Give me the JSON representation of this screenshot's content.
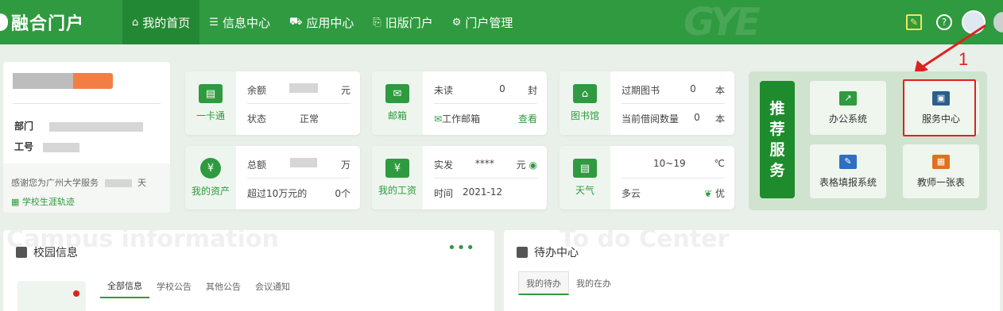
{
  "topbar": {
    "logo": "融合门户",
    "nav": [
      {
        "label": "我的首页",
        "icon": "home-icon",
        "glyph": "⌂"
      },
      {
        "label": "信息中心",
        "icon": "list-icon",
        "glyph": "☰"
      },
      {
        "label": "应用中心",
        "icon": "cart-icon",
        "glyph": "⛟"
      },
      {
        "label": "旧版门户",
        "icon": "portal-icon",
        "glyph": "⎘"
      },
      {
        "label": "门户管理",
        "icon": "gear-icon",
        "glyph": "⚙"
      }
    ],
    "brand_color": "#2f9a3f"
  },
  "annotation": {
    "number": "1",
    "color": "#e02020"
  },
  "profile": {
    "dept_label": "部门",
    "id_label": "工号",
    "service_text": "感谢您为广州大学服务",
    "service_unit": "天",
    "career_link": "学校生涯轨迹"
  },
  "cards": {
    "card_campus": {
      "label": "一卡通",
      "row1_label": "余额",
      "row1_unit": "元",
      "row2_label": "状态",
      "row2_value": "正常"
    },
    "card_mail": {
      "label": "邮箱",
      "row1_label": "未读",
      "row1_value": "0",
      "row1_unit": "封",
      "row2_label": "工作邮箱",
      "row2_link": "查看"
    },
    "card_library": {
      "label": "图书馆",
      "row1_label": "过期图书",
      "row1_value": "0",
      "row1_unit": "本",
      "row2_label": "当前借阅数量",
      "row2_value": "0",
      "row2_unit": "本"
    },
    "card_assets": {
      "label": "我的资产",
      "row1_label": "总额",
      "row1_unit": "万",
      "row2_label": "超过10万元的",
      "row2_value": "0个"
    },
    "card_salary": {
      "label": "我的工资",
      "row1_label": "实发",
      "row1_value": "****",
      "row1_unit": "元",
      "row2_label": "时间",
      "row2_value": "2021-12"
    },
    "card_weather": {
      "label": "天气",
      "row1_value": "10~19",
      "row1_unit": "℃",
      "row2_label": "多云",
      "row2_value": "优"
    }
  },
  "recommend": {
    "banner": [
      "推",
      "荐",
      "服",
      "务"
    ],
    "tiles": [
      {
        "label": "办公系统",
        "icon": "office-icon",
        "color": "#2f9a3f"
      },
      {
        "label": "服务中心",
        "icon": "service-center-icon",
        "color": "#2a5f8a"
      },
      {
        "label": "表格填报系统",
        "icon": "form-icon",
        "color": "#2d6fc4"
      },
      {
        "label": "教师一张表",
        "icon": "teacher-table-icon",
        "color": "#e0701f"
      }
    ]
  },
  "campus": {
    "watermark": "Campus information",
    "title": "校园信息",
    "more": "•••",
    "tabs": [
      "全部信息",
      "学校公告",
      "其他公告",
      "会议通知"
    ]
  },
  "todo": {
    "watermark": "To do Center",
    "title": "待办中心",
    "tabs": [
      "我的待办",
      "我的在办"
    ]
  }
}
